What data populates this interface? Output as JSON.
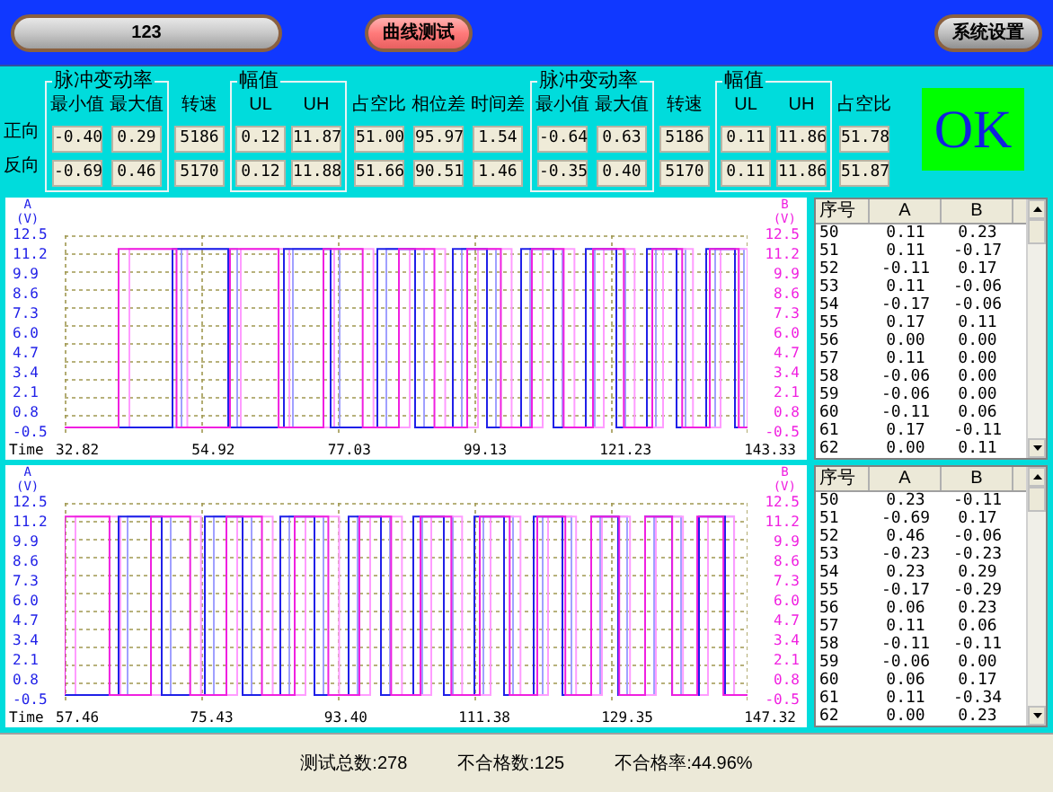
{
  "top_bar": {
    "title_field": "123",
    "buttons": [
      {
        "label": "曲线测试",
        "kind": "pink"
      },
      {
        "label": "系统设置",
        "kind": "gray"
      }
    ]
  },
  "params": {
    "row_labels": [
      "正向",
      "反向"
    ],
    "columns": [
      {
        "kind": "group",
        "title": "脉冲变动率",
        "subcolumns": [
          {
            "header": "最小值",
            "values": [
              "-0.40",
              "-0.69"
            ]
          },
          {
            "header": "最大值",
            "values": [
              "0.29",
              "0.46"
            ]
          }
        ]
      },
      {
        "kind": "single",
        "header": "转速",
        "values": [
          "5186",
          "5170"
        ]
      },
      {
        "kind": "group",
        "title": "幅值",
        "subcolumns": [
          {
            "header": "UL",
            "values": [
              "0.12",
              "0.12"
            ]
          },
          {
            "header": "UH",
            "values": [
              "11.87",
              "11.88"
            ]
          }
        ]
      },
      {
        "kind": "single",
        "header": "占空比",
        "values": [
          "51.00",
          "51.66"
        ]
      },
      {
        "kind": "single",
        "header": "相位差",
        "values": [
          "95.97",
          "90.51"
        ]
      },
      {
        "kind": "single",
        "header": "时间差",
        "values": [
          "1.54",
          "1.46"
        ]
      },
      {
        "kind": "group",
        "title": "脉冲变动率",
        "subcolumns": [
          {
            "header": "最小值",
            "values": [
              "-0.64",
              "-0.35"
            ]
          },
          {
            "header": "最大值",
            "values": [
              "0.63",
              "0.40"
            ]
          }
        ]
      },
      {
        "kind": "single",
        "header": "转速",
        "values": [
          "5186",
          "5170"
        ]
      },
      {
        "kind": "group",
        "title": "幅值",
        "subcolumns": [
          {
            "header": "UL",
            "values": [
              "0.11",
              "0.11"
            ]
          },
          {
            "header": "UH",
            "values": [
              "11.86",
              "11.86"
            ]
          }
        ]
      },
      {
        "kind": "single",
        "header": "占空比",
        "values": [
          "51.78",
          "51.87"
        ]
      }
    ],
    "result": {
      "label": "OK",
      "pass": true
    }
  },
  "panels": [
    {
      "chart": {
        "left_axis": {
          "name": "A",
          "unit": "(V)",
          "ticks": [
            "12.5",
            "11.2",
            "9.9",
            "8.6",
            "7.3",
            "6.0",
            "4.7",
            "3.4",
            "2.1",
            "0.8",
            "-0.5"
          ]
        },
        "right_axis": {
          "name": "B",
          "unit": "(V)",
          "ticks": [
            "12.5",
            "11.2",
            "9.9",
            "8.6",
            "7.3",
            "6.0",
            "4.7",
            "3.4",
            "2.1",
            "0.8",
            "-0.5"
          ]
        },
        "time_label": "Time",
        "x_labels": [
          "32.82",
          "54.92",
          "77.03",
          "99.13",
          "121.23",
          "143.33"
        ]
      },
      "table": {
        "columns": [
          "序号",
          "A",
          "B"
        ],
        "rows": [
          [
            "50",
            "0.11",
            "0.23"
          ],
          [
            "51",
            "0.11",
            "-0.17"
          ],
          [
            "52",
            "-0.11",
            "0.17"
          ],
          [
            "53",
            "0.11",
            "-0.06"
          ],
          [
            "54",
            "-0.17",
            "-0.06"
          ],
          [
            "55",
            "0.17",
            "0.11"
          ],
          [
            "56",
            "0.00",
            "0.00"
          ],
          [
            "57",
            "0.11",
            "0.00"
          ],
          [
            "58",
            "-0.06",
            "0.00"
          ],
          [
            "59",
            "-0.06",
            "0.00"
          ],
          [
            "60",
            "-0.11",
            "0.06"
          ],
          [
            "61",
            "0.17",
            "-0.11"
          ],
          [
            "62",
            "0.00",
            "0.11"
          ]
        ]
      }
    },
    {
      "chart": {
        "left_axis": {
          "name": "A",
          "unit": "(V)",
          "ticks": [
            "12.5",
            "11.2",
            "9.9",
            "8.6",
            "7.3",
            "6.0",
            "4.7",
            "3.4",
            "2.1",
            "0.8",
            "-0.5"
          ]
        },
        "right_axis": {
          "name": "B",
          "unit": "(V)",
          "ticks": [
            "12.5",
            "11.2",
            "9.9",
            "8.6",
            "7.3",
            "6.0",
            "4.7",
            "3.4",
            "2.1",
            "0.8",
            "-0.5"
          ]
        },
        "time_label": "Time",
        "x_labels": [
          "57.46",
          "75.43",
          "93.40",
          "111.38",
          "129.35",
          "147.32"
        ]
      },
      "table": {
        "columns": [
          "序号",
          "A",
          "B"
        ],
        "rows": [
          [
            "50",
            "0.23",
            "-0.11"
          ],
          [
            "51",
            "-0.69",
            "0.17"
          ],
          [
            "52",
            "0.46",
            "-0.06"
          ],
          [
            "53",
            "-0.23",
            "-0.23"
          ],
          [
            "54",
            "0.23",
            "0.29"
          ],
          [
            "55",
            "-0.17",
            "-0.29"
          ],
          [
            "56",
            "0.06",
            "0.23"
          ],
          [
            "57",
            "0.11",
            "0.06"
          ],
          [
            "58",
            "-0.11",
            "-0.11"
          ],
          [
            "59",
            "-0.06",
            "0.00"
          ],
          [
            "60",
            "0.06",
            "0.17"
          ],
          [
            "61",
            "0.11",
            "-0.34"
          ],
          [
            "62",
            "0.00",
            "0.23"
          ]
        ]
      }
    }
  ],
  "status_bar": [
    "测试总数:278",
    "不合格数:125",
    "不合格率:44.96%"
  ]
}
